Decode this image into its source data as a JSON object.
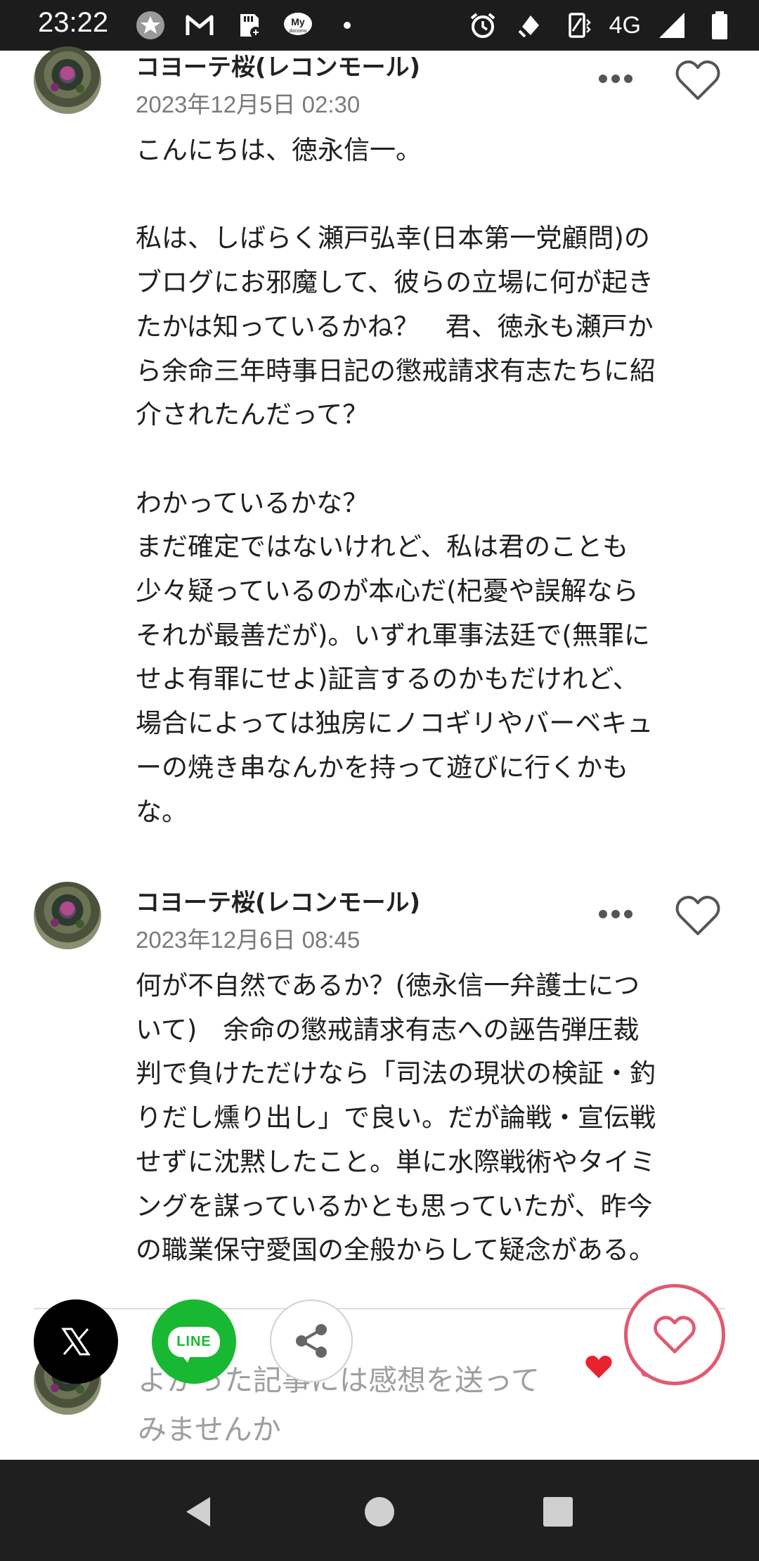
{
  "status_bar": {
    "time": "23:22",
    "left_icons": [
      "star-badge-icon",
      "gmail-icon",
      "sd-card-icon",
      "my-docomo-icon",
      "dot-icon"
    ],
    "my_docomo_top": "My",
    "my_docomo_bottom": "docomo",
    "network": "4G",
    "right_icons": [
      "alarm-icon",
      "data-saver-icon",
      "vibrate-icon",
      "signal-icon",
      "battery-icon"
    ]
  },
  "comments": [
    {
      "author": "コヨーテ桜(レコンモール)",
      "date": "2023年12月5日 02:30",
      "body": "こんにちは、徳永信一。\n\n私は、しばらく瀬戸弘幸(日本第一党顧問)の\nブログにお邪魔して、彼らの立場に何が起き\nたかは知っているかね？　君、徳永も瀬戸か\nら余命三年時事日記の懲戒請求有志たちに紹\n介されたんだって？\n\nわかっているかな？\nまだ確定ではないけれど、私は君のことも\n少々疑っているのが本心だ(杞憂や誤解なら\nそれが最善だが)。いずれ軍事法廷で(無罪に\nせよ有罪にせよ)証言するのかもだけれど、\n場合によっては独房にノコギリやバーベキュ\nーの焼き串なんかを持って遊びに行くかも\nな。"
    },
    {
      "author": "コヨーテ桜(レコンモール)",
      "date": "2023年12月6日 08:45",
      "body": "何が不自然であるか？(徳永信一弁護士につ\nいて)　余命の懲戒請求有志への誣告弾圧裁\n判で負けただけなら「司法の現状の検証・釣\nりだし燻り出し」で良い。だが論戦・宣伝戦\nせずに沈黙したこと。単に水際戦術やタイミ\nングを謀っているかとも思っていたが、昨今\nの職業保守愛国の全般からして疑念がある。"
    }
  ],
  "feedback": {
    "placeholder": "よかった記事には感想を送ってみませんか"
  },
  "share": {
    "x_icon": "x-logo-icon",
    "line_label": "LINE",
    "share_icon": "share-icon",
    "like_icon": "heart-icon"
  },
  "colors": {
    "accent_pink": "#e4586f",
    "line_green": "#19b832",
    "heart_red": "#e8232f"
  }
}
